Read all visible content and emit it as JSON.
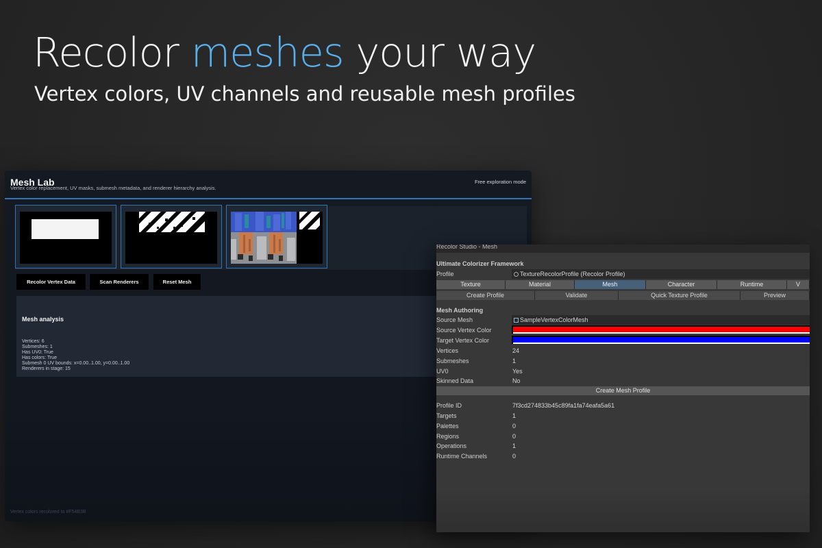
{
  "hero": {
    "title_part1": "Recolor ",
    "title_accent": "meshes",
    "title_part2": " your way",
    "subtitle": "Vertex colors, UV channels and reusable mesh profiles",
    "accent_color": "#5aafeb"
  },
  "mesh_lab": {
    "title": "Mesh Lab",
    "subtitle": "Vertex color replacement, UV masks, submesh metadata, and renderer hierarchy analysis.",
    "mode": "Free exploration mode",
    "accent_color": "#2f73b8",
    "buttons": [
      "Recolor Vertex Data",
      "Scan Renderers",
      "Reset Mesh"
    ],
    "analysis_title": "Mesh analysis",
    "stats": [
      "Vertices: 6",
      "Submeshes: 1",
      "Has UV0: True",
      "Has colors: True",
      "Submesh 0 UV bounds: x=0.00..1.00, y=0.00..1.00",
      "Renderers in stage: 15"
    ],
    "footer": "Vertex colors recolored to #F54B3B"
  },
  "studio": {
    "window_title": "Recolor Studio - Mesh",
    "framework": "Ultimate Colorizer Framework",
    "profile_label": "Profile",
    "profile_value": "TextureRecolorProfile (Recolor Profile)",
    "tabs": [
      "Texture",
      "Material",
      "Mesh",
      "Character",
      "Runtime",
      "V"
    ],
    "active_tab": "Mesh",
    "actions": [
      "Create Profile",
      "Validate",
      "Quick Texture Profile",
      "Preview"
    ],
    "section_title": "Mesh Authoring",
    "source_mesh_label": "Source Mesh",
    "source_mesh_value": "SampleVertexColorMesh",
    "source_color_label": "Source Vertex Color",
    "source_color": "#ff0000",
    "target_color_label": "Target Vertex Color",
    "target_color": "#0000ff",
    "mesh_info": [
      {
        "label": "Vertices",
        "value": "24"
      },
      {
        "label": "Submeshes",
        "value": "1"
      },
      {
        "label": "UV0",
        "value": "Yes"
      },
      {
        "label": "Skinned Data",
        "value": "No"
      }
    ],
    "create_button": "Create Mesh Profile",
    "profile_info": [
      {
        "label": "Profile ID",
        "value": "7f3cd274833b45c89fa1fa74eafa5a61"
      },
      {
        "label": "Targets",
        "value": "1"
      },
      {
        "label": "Palettes",
        "value": "0"
      },
      {
        "label": "Regions",
        "value": "0"
      },
      {
        "label": "Operations",
        "value": "1"
      },
      {
        "label": "Runtime Channels",
        "value": "0"
      }
    ]
  }
}
